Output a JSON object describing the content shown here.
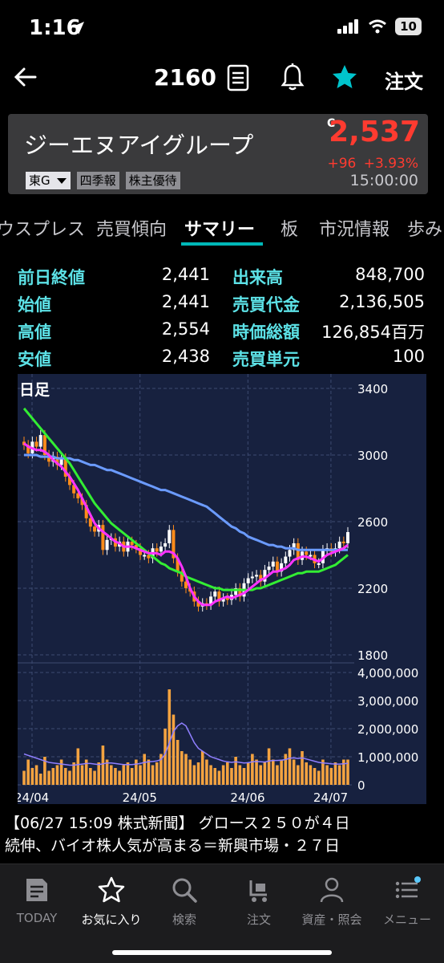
{
  "status_bar": {
    "time": "1:16",
    "battery": "10"
  },
  "nav": {
    "code": "2160",
    "order_label": "注文"
  },
  "stock": {
    "name": "ジーエヌアイグループ",
    "market": "東G",
    "chips": [
      "四季報",
      "株主優待"
    ],
    "price_marker": "C",
    "price": "2,537",
    "change": "+96",
    "change_pct": "+3.93%",
    "time": "15:00:00"
  },
  "tabs": [
    "ウスプレス",
    "売買傾向",
    "サマリー",
    "板",
    "市況情報",
    "歩み"
  ],
  "summary": [
    {
      "label_left": "前日終値",
      "value_left": "2,441",
      "label_right": "出来高",
      "value_right": "848,700"
    },
    {
      "label_left": "始値",
      "value_left": "2,441",
      "label_right": "売買代金",
      "value_right": "2,136,505"
    },
    {
      "label_left": "高値",
      "value_left": "2,554",
      "label_right": "時価総額",
      "value_right": "126,854百万"
    },
    {
      "label_left": "安値",
      "value_left": "2,438",
      "label_right": "売買単元",
      "value_right": "100"
    }
  ],
  "chart_data": {
    "type": "line",
    "title": "日足",
    "price_ylim": [
      1800,
      3400
    ],
    "price_ticks": [
      "3400",
      "3000",
      "2600",
      "2200",
      "1800"
    ],
    "volume_ylim": [
      0,
      4000000
    ],
    "volume_ticks": [
      "4,000,000",
      "3,000,000",
      "2,000,000",
      "1,000,000",
      "0"
    ],
    "x_ticks": [
      "24/04",
      "24/05",
      "24/06",
      "24/07"
    ],
    "grid": true,
    "colors": {
      "ma_short": "#ff33ff",
      "ma_mid": "#33ee33",
      "ma_long": "#6b9bff",
      "bg": "#17213f",
      "candle_up": "#ffffff",
      "candle_down": "#ff8c1a",
      "volume": "#f4a340"
    },
    "closes": [
      3060,
      3010,
      3080,
      3050,
      3120,
      3000,
      2960,
      2990,
      2940,
      2980,
      2870,
      2820,
      2770,
      2740,
      2700,
      2620,
      2570,
      2540,
      2580,
      2430,
      2490,
      2500,
      2450,
      2480,
      2420,
      2480,
      2460,
      2440,
      2400,
      2400,
      2380,
      2440,
      2420,
      2450,
      2470,
      2550,
      2380,
      2300,
      2240,
      2200,
      2180,
      2120,
      2090,
      2110,
      2100,
      2150,
      2180,
      2120,
      2140,
      2130,
      2160,
      2200,
      2150,
      2230,
      2260,
      2270,
      2280,
      2240,
      2310,
      2330,
      2360,
      2300,
      2350,
      2390,
      2430,
      2470,
      2370,
      2420,
      2400,
      2400,
      2350,
      2350,
      2430,
      2440,
      2420,
      2440,
      2480,
      2470,
      2537
    ],
    "ma_short": [
      3070,
      3050,
      3040,
      3030,
      3030,
      3020,
      3000,
      2970,
      2950,
      2930,
      2900,
      2870,
      2830,
      2790,
      2740,
      2690,
      2640,
      2590,
      2560,
      2540,
      2520,
      2500,
      2480,
      2470,
      2450,
      2450,
      2450,
      2440,
      2430,
      2420,
      2410,
      2410,
      2410,
      2400,
      2420,
      2420,
      2410,
      2380,
      2330,
      2270,
      2200,
      2150,
      2120,
      2100,
      2100,
      2100,
      2120,
      2130,
      2140,
      2150,
      2140,
      2150,
      2160,
      2170,
      2190,
      2210,
      2230,
      2250,
      2260,
      2280,
      2300,
      2300,
      2310,
      2320,
      2340,
      2370,
      2380,
      2390,
      2390,
      2380,
      2370,
      2360,
      2380,
      2400,
      2410,
      2420,
      2430,
      2440,
      2460
    ],
    "ma_mid": [
      3280,
      3250,
      3220,
      3190,
      3160,
      3130,
      3100,
      3070,
      3040,
      3010,
      2980,
      2950,
      2910,
      2870,
      2830,
      2790,
      2750,
      2710,
      2680,
      2650,
      2620,
      2590,
      2570,
      2550,
      2530,
      2510,
      2490,
      2470,
      2450,
      2430,
      2410,
      2390,
      2370,
      2350,
      2340,
      2320,
      2310,
      2300,
      2290,
      2270,
      2260,
      2250,
      2240,
      2230,
      2220,
      2210,
      2200,
      2200,
      2190,
      2190,
      2190,
      2190,
      2190,
      2190,
      2190,
      2190,
      2200,
      2200,
      2210,
      2220,
      2230,
      2240,
      2250,
      2260,
      2270,
      2280,
      2290,
      2290,
      2300,
      2300,
      2300,
      2300,
      2310,
      2320,
      2330,
      2340,
      2360,
      2380,
      2400
    ],
    "ma_long": [
      3000,
      3000,
      3000,
      3000,
      2990,
      2990,
      2990,
      2990,
      2980,
      2980,
      2980,
      2980,
      2970,
      2970,
      2960,
      2950,
      2940,
      2940,
      2930,
      2920,
      2910,
      2910,
      2900,
      2890,
      2880,
      2870,
      2860,
      2850,
      2840,
      2830,
      2820,
      2810,
      2800,
      2790,
      2790,
      2780,
      2770,
      2760,
      2750,
      2740,
      2730,
      2720,
      2710,
      2700,
      2690,
      2670,
      2650,
      2630,
      2610,
      2590,
      2570,
      2560,
      2540,
      2530,
      2510,
      2500,
      2490,
      2480,
      2470,
      2460,
      2460,
      2450,
      2450,
      2440,
      2440,
      2440,
      2430,
      2430,
      2430,
      2430,
      2430,
      2430,
      2430,
      2430,
      2430,
      2430,
      2430,
      2430,
      2430
    ],
    "volumes": [
      500000,
      900000,
      600000,
      700000,
      400000,
      1000000,
      500000,
      600000,
      700000,
      900000,
      600000,
      500000,
      800000,
      1300000,
      700000,
      900000,
      600000,
      500000,
      800000,
      1400000,
      900000,
      700000,
      600000,
      500000,
      700000,
      800000,
      600000,
      900000,
      700000,
      1100000,
      900000,
      700000,
      800000,
      1100000,
      2000000,
      3400000,
      2500000,
      1600000,
      1200000,
      1100000,
      900000,
      700000,
      800000,
      1200000,
      900000,
      700000,
      600000,
      500000,
      700000,
      800000,
      600000,
      1000000,
      700000,
      600000,
      800000,
      1100000,
      900000,
      700000,
      800000,
      1300000,
      900000,
      700000,
      900000,
      1100000,
      1300000,
      900000,
      700000,
      1200000,
      800000,
      700000,
      600000,
      500000,
      900000,
      700000,
      600000,
      800000,
      700000,
      900000,
      900000
    ],
    "volume_ma": [
      1100000,
      1050000,
      1000000,
      950000,
      900000,
      850000,
      800000,
      780000,
      760000,
      740000,
      720000,
      700000,
      700000,
      720000,
      740000,
      760000,
      760000,
      740000,
      720000,
      750000,
      780000,
      780000,
      760000,
      740000,
      720000,
      720000,
      720000,
      740000,
      760000,
      800000,
      820000,
      830000,
      850000,
      900000,
      1100000,
      1500000,
      1900000,
      2100000,
      2200000,
      2100000,
      1800000,
      1500000,
      1300000,
      1200000,
      1100000,
      1000000,
      950000,
      900000,
      850000,
      820000,
      800000,
      820000,
      800000,
      780000,
      790000,
      820000,
      830000,
      820000,
      810000,
      850000,
      870000,
      870000,
      880000,
      900000,
      950000,
      960000,
      940000,
      960000,
      920000,
      880000,
      840000,
      800000,
      780000,
      770000,
      750000,
      740000,
      740000,
      750000,
      770000
    ]
  },
  "news": {
    "line1": "【06/27 15:09 株式新聞】 グロース２５０が４日",
    "line2": "続伸、バイオ株人気が高まる＝新興市場・２７日"
  },
  "bottom_nav": [
    "TODAY",
    "お気に入り",
    "検索",
    "注文",
    "資産・照会",
    "メニュー"
  ]
}
